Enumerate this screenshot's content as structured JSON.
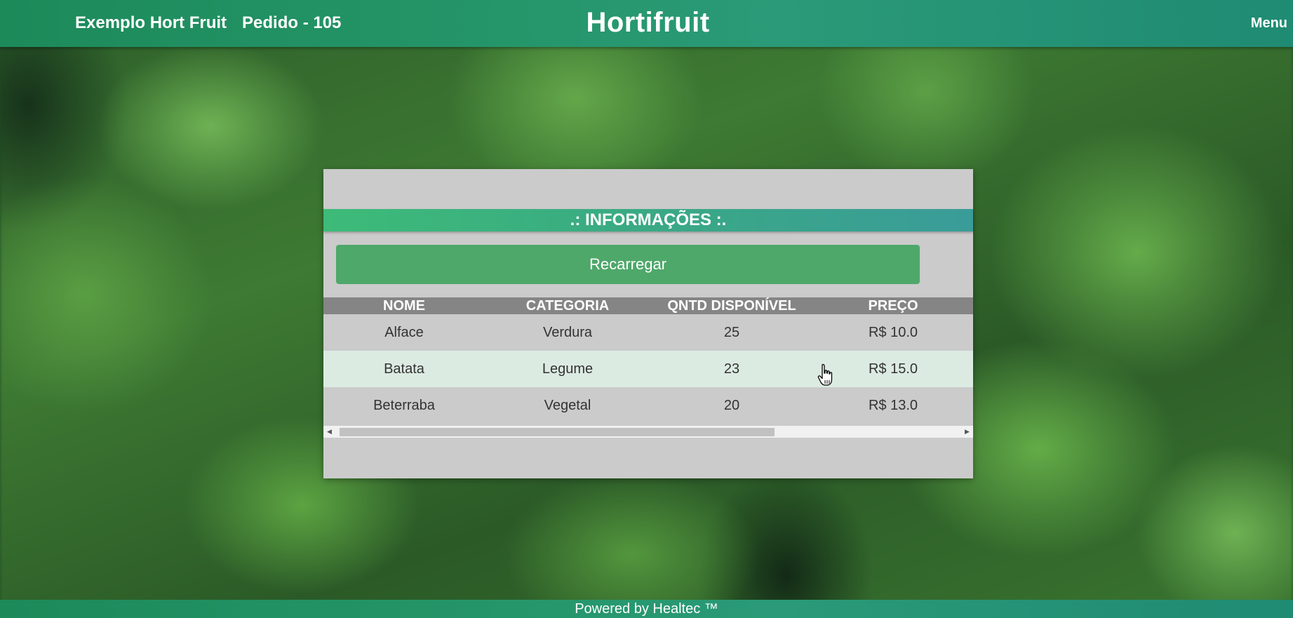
{
  "header": {
    "store_name": "Exemplo Hort Fruit",
    "order_label": "Pedido - 105",
    "app_title": "Hortifruit",
    "menu_label": "Menu"
  },
  "panel": {
    "section_title": ".: INFORMAÇÕES :.",
    "reload_label": "Recarregar",
    "table": {
      "columns": [
        "NOME",
        "CATEGORIA",
        "QNTD DISPONÍVEL",
        "PREÇO"
      ],
      "rows": [
        {
          "nome": "Alface",
          "categoria": "Verdura",
          "qntd": "25",
          "preco": "R$ 10.0"
        },
        {
          "nome": "Batata",
          "categoria": "Legume",
          "qntd": "23",
          "preco": "R$ 15.0"
        },
        {
          "nome": "Beterraba",
          "categoria": "Vegetal",
          "qntd": "20",
          "preco": "R$ 13.0"
        }
      ]
    },
    "scrollbar": {
      "left_arrow_icon": "triangle-left-icon",
      "right_arrow_icon": "triangle-right-icon"
    }
  },
  "footer": {
    "text": "Powered by Healtec ™"
  },
  "colors": {
    "header_green": "#25966a",
    "banner_start": "#3dbb78",
    "banner_end": "#3a9c99",
    "button_green": "#4ea86a",
    "table_header_gray": "#858585",
    "row_highlight": "#dcebe2",
    "panel_gray": "#cbcbcb"
  }
}
